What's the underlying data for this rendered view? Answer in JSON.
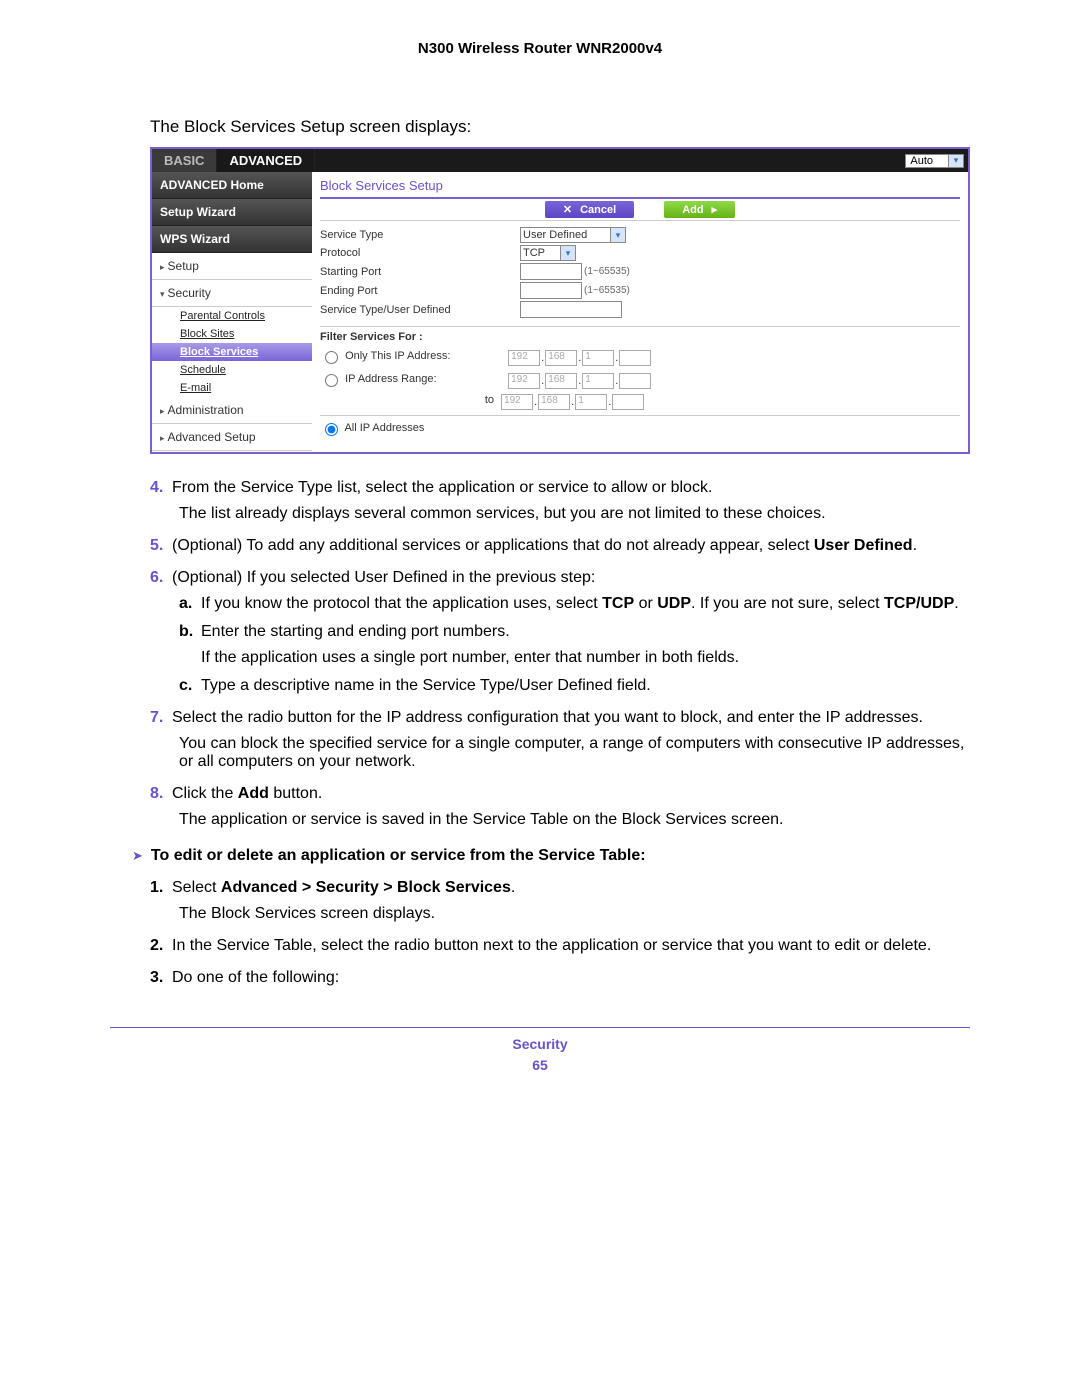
{
  "header": {
    "title": "N300 Wireless Router WNR2000v4"
  },
  "intro": "The Block Services Setup screen displays:",
  "ui": {
    "tabs": {
      "basic": "BASIC",
      "advanced": "ADVANCED"
    },
    "topbar": {
      "auto": "Auto"
    },
    "sidebar": {
      "adv_home": "ADVANCED Home",
      "setup_wizard": "Setup Wizard",
      "wps_wizard": "WPS Wizard",
      "setup": "Setup",
      "security": "Security",
      "parental_controls": "Parental Controls",
      "block_sites": "Block Sites",
      "block_services": "Block Services",
      "schedule": "Schedule",
      "email": "E-mail",
      "administration": "Administration",
      "advanced_setup": "Advanced Setup"
    },
    "content": {
      "title": "Block Services Setup",
      "cancel": "Cancel",
      "add": "Add",
      "service_type_label": "Service Type",
      "service_type_value": "User Defined",
      "protocol_label": "Protocol",
      "protocol_value": "TCP",
      "starting_port_label": "Starting Port",
      "ending_port_label": "Ending Port",
      "port_hint": "(1~65535)",
      "stud_label": "Service Type/User Defined",
      "filter_for": "Filter Services For :",
      "only_this": "Only This IP Address:",
      "ip_range": "IP Address Range:",
      "to": "to",
      "all_ip": "All IP Addresses",
      "ip": {
        "a": "192",
        "b": "168",
        "c": "1"
      }
    }
  },
  "steps": {
    "s4": {
      "num": "4.",
      "text": "From the Service Type list, select the application or service to allow or block.",
      "body": "The list already displays several common services, but you are not limited to these choices."
    },
    "s5": {
      "num": "5.",
      "pre": "(Optional) To add any additional services or applications that do not already appear, select ",
      "bold": "User Defined",
      "post": "."
    },
    "s6": {
      "num": "6.",
      "text": "(Optional) If you selected User Defined in the previous step:",
      "a": {
        "let": "a.",
        "t1": "If you know the protocol that the application uses, select ",
        "b1": "TCP",
        "t2": " or ",
        "b2": "UDP",
        "t3": ". If you are not sure, select ",
        "b3": "TCP/UDP",
        "t4": "."
      },
      "b": {
        "let": "b.",
        "text": "Enter the starting and ending port numbers.",
        "body": "If the application uses a single port number, enter that number in both fields."
      },
      "c": {
        "let": "c.",
        "text": "Type a descriptive name in the Service Type/User Defined field."
      }
    },
    "s7": {
      "num": "7.",
      "text": "Select the radio button for the IP address configuration that you want to block, and enter the IP addresses.",
      "body": "You can block the specified service for a single computer, a range of computers with consecutive IP addresses, or all computers on your network."
    },
    "s8": {
      "num": "8.",
      "t1": "Click the ",
      "bold": "Add",
      "t2": " button.",
      "body": "The application or service is saved in the Service Table on the Block Services screen."
    }
  },
  "proc2": {
    "heading": "To edit or delete an application or service from the Service Table:",
    "s1": {
      "num": "1.",
      "t1": "Select ",
      "bold": "Advanced > Security > Block Services",
      "t2": ".",
      "body": "The Block Services screen displays."
    },
    "s2": {
      "num": "2.",
      "text": "In the Service Table, select the radio button next to the application or service that you want to edit or delete."
    },
    "s3": {
      "num": "3.",
      "text": "Do one of the following:"
    }
  },
  "footer": {
    "section": "Security",
    "page": "65"
  }
}
